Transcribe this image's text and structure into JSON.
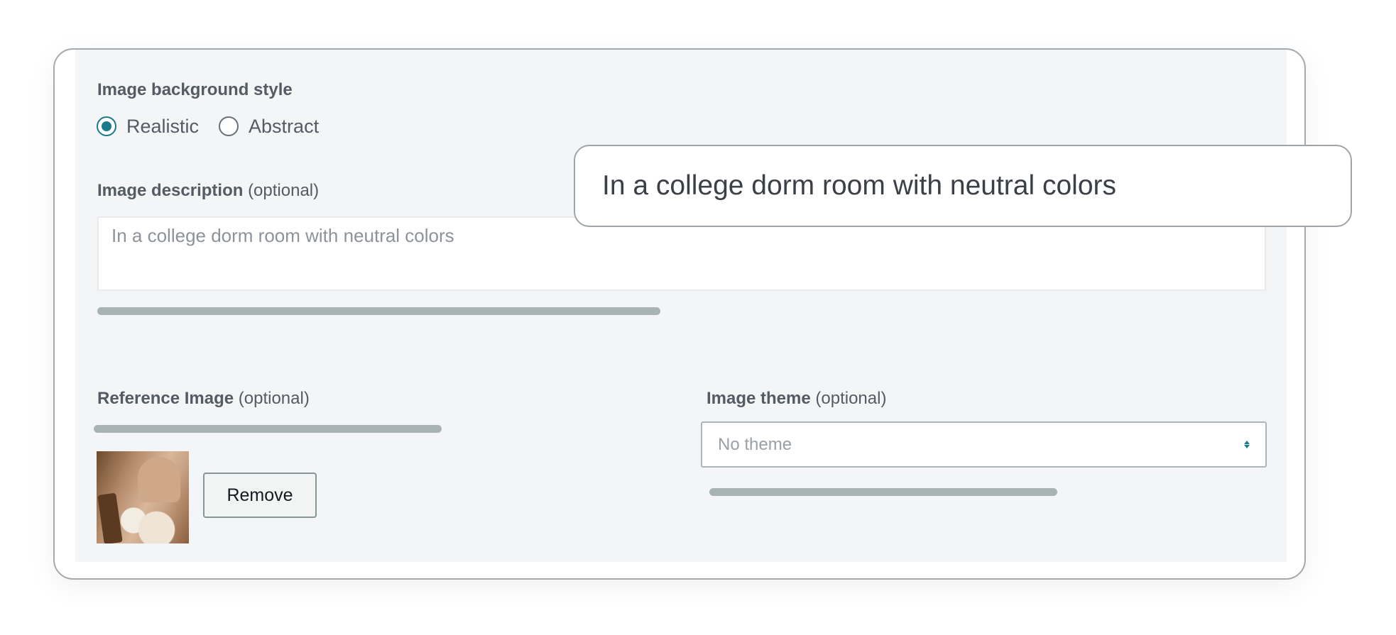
{
  "background_style": {
    "label": "Image background style",
    "options": [
      {
        "label": "Realistic",
        "selected": true
      },
      {
        "label": "Abstract",
        "selected": false
      }
    ]
  },
  "description": {
    "label": "Image description",
    "optional": "(optional)",
    "placeholder": "In a college dorm room with neutral colors"
  },
  "reference": {
    "label": "Reference Image",
    "optional": "(optional)",
    "remove_label": "Remove"
  },
  "theme": {
    "label": "Image theme",
    "optional": "(optional)",
    "selected": "No theme"
  },
  "callout": {
    "text": "In a college dorm room with neutral colors"
  },
  "colors": {
    "accent": "#1a7a8c",
    "panel_bg": "#f4f5f7",
    "label_text": "#545b64",
    "placeholder_text": "#8d9399"
  }
}
